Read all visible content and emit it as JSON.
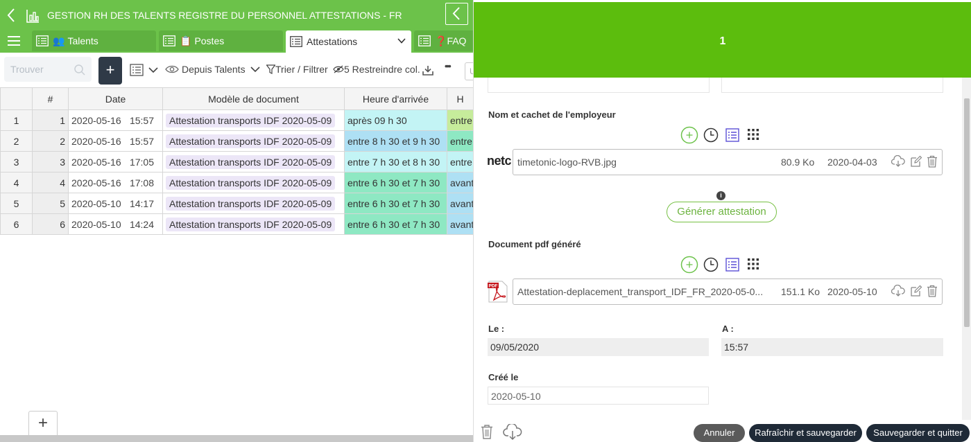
{
  "app": {
    "title": "GESTION RH DES TALENTS REGISTRE DU PERSONNEL ATTESTATIONS - FR",
    "tabs": [
      {
        "label": "Talents",
        "emoji": "👥",
        "active": false
      },
      {
        "label": "Postes",
        "emoji": "📋",
        "active": false
      },
      {
        "label": "Attestations",
        "emoji": "",
        "active": true
      },
      {
        "label": "FAQ",
        "emoji": "❓",
        "active": false
      }
    ]
  },
  "toolbar": {
    "search_placeholder": "Trouver",
    "add_label": "+",
    "from_label": "Depuis Talents",
    "sort_filter_label": "Trier / Filtrer",
    "restrict_label": "5 Restreindre col.",
    "more_label": "•••",
    "truncated_label": "U"
  },
  "grid": {
    "columns": [
      "#",
      "Date",
      "Modèle de document",
      "Heure d'arrivée",
      "H"
    ],
    "rows": [
      {
        "rownum": "1",
        "idx": "1",
        "date": "2020-05-16",
        "time": "15:57",
        "model": "Attestation transports IDF 2020-05-09",
        "arrival": "après 09 h 30",
        "arrival_color": "c-cyan",
        "next": "entre",
        "next_color": "c-lime"
      },
      {
        "rownum": "2",
        "idx": "2",
        "date": "2020-05-16",
        "time": "15:57",
        "model": "Attestation transports IDF 2020-05-09",
        "arrival": "entre 8 h 30 et 9 h 30",
        "arrival_color": "c-blue",
        "next": "entre",
        "next_color": "c-teal"
      },
      {
        "rownum": "3",
        "idx": "3",
        "date": "2020-05-16",
        "time": "17:05",
        "model": "Attestation transports IDF 2020-05-09",
        "arrival": "entre 7 h 30 et 8 h 30",
        "arrival_color": "c-cyan",
        "next": "entre",
        "next_color": "c-cyan"
      },
      {
        "rownum": "4",
        "idx": "4",
        "date": "2020-05-16",
        "time": "17:08",
        "model": "Attestation transports IDF 2020-05-09",
        "arrival": "entre 6 h 30 et 7 h 30",
        "arrival_color": "c-teal",
        "next": "avant",
        "next_color": "c-lblue"
      },
      {
        "rownum": "5",
        "idx": "5",
        "date": "2020-05-10",
        "time": "14:17",
        "model": "Attestation transports IDF 2020-05-09",
        "arrival": "entre 6 h 30 et 7 h 30",
        "arrival_color": "c-teal",
        "next": "avant",
        "next_color": "c-lblue"
      },
      {
        "rownum": "6",
        "idx": "6",
        "date": "2020-05-10",
        "time": "14:24",
        "model": "Attestation transports IDF 2020-05-09",
        "arrival": "entre 6 h 30 et 7 h 30",
        "arrival_color": "c-teal",
        "next": "avant",
        "next_color": "c-lblue"
      }
    ],
    "add_row_label": "+"
  },
  "panel": {
    "header_title": "1",
    "employer_section": {
      "label": "Nom et cachet de l'employeur",
      "thumb_text": "netc",
      "file_name": "timetonic-logo-RVB.jpg",
      "file_size": "80.9 Ko",
      "file_date": "2020-04-03"
    },
    "generate_button": "Générer attestation",
    "pdf_section": {
      "label": "Document pdf généré",
      "file_name": "Attestation-deplacement_transport_IDF_FR_2020-05-0...",
      "file_size": "151.1 Ko",
      "file_date": "2020-05-10"
    },
    "le_label": "Le :",
    "le_value": "09/05/2020",
    "a_label": "A :",
    "a_value": "15:57",
    "created_label": "Créé le",
    "created_value": "2020-05-10",
    "footer": {
      "cancel": "Annuler",
      "refresh_save": "Rafraîchir et sauvegarder",
      "save_quit": "Sauvegarder et quitter"
    }
  },
  "colors": {
    "brand_green": "#6cc24a",
    "panel_header_green": "#5cbd0d",
    "dark_button": "#1f2a37",
    "cancel_button": "#5a5a5a"
  }
}
